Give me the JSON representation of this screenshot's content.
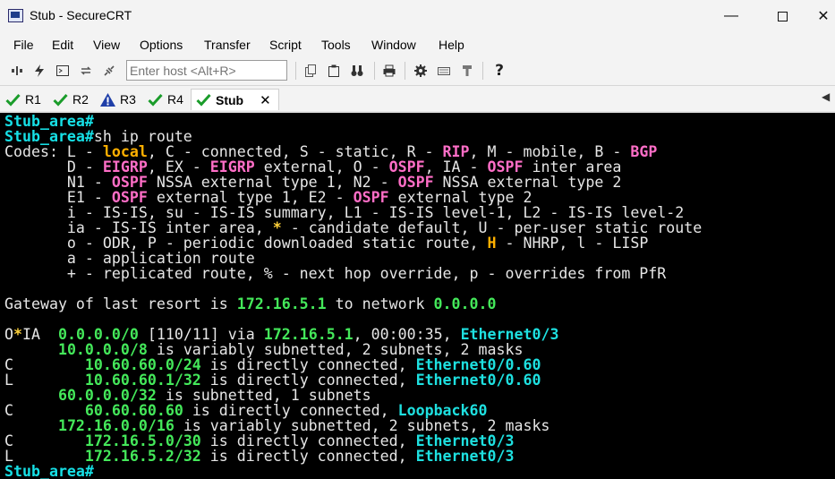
{
  "window": {
    "title": "Stub - SecureCRT",
    "min_glyph": "—",
    "close_glyph": "✕"
  },
  "menu": [
    "File",
    "Edit",
    "View",
    "Options",
    "Transfer",
    "Script",
    "Tools",
    "Window",
    "Help"
  ],
  "toolbar": {
    "host_placeholder": "Enter host <Alt+R>",
    "help_glyph": "?"
  },
  "tabs": [
    {
      "label": "R1",
      "status": "connected"
    },
    {
      "label": "R2",
      "status": "connected"
    },
    {
      "label": "R3",
      "status": "warning"
    },
    {
      "label": "R4",
      "status": "connected"
    },
    {
      "label": "Stub",
      "status": "connected",
      "active": true,
      "close": "✕"
    }
  ],
  "tab_scroll_glyph": "◀",
  "terminal": {
    "lines": [
      [
        {
          "t": "Stub_area#",
          "c": "prompt"
        }
      ],
      [
        {
          "t": "Stub_area#",
          "c": "prompt"
        },
        {
          "t": "sh ip route"
        }
      ],
      [
        {
          "t": "Codes: L - "
        },
        {
          "t": "local",
          "c": "kw-orange"
        },
        {
          "t": ", C - connected, S - static, R - "
        },
        {
          "t": "RIP",
          "c": "kw-pink"
        },
        {
          "t": ", M - mobile, B - "
        },
        {
          "t": "BGP",
          "c": "kw-pink"
        }
      ],
      [
        {
          "t": "       D - "
        },
        {
          "t": "EIGRP",
          "c": "kw-pink"
        },
        {
          "t": ", EX - "
        },
        {
          "t": "EIGRP",
          "c": "kw-pink"
        },
        {
          "t": " external, O - "
        },
        {
          "t": "OSPF",
          "c": "kw-pink"
        },
        {
          "t": ", IA - "
        },
        {
          "t": "OSPF",
          "c": "kw-pink"
        },
        {
          "t": " inter area"
        }
      ],
      [
        {
          "t": "       N1 - "
        },
        {
          "t": "OSPF",
          "c": "kw-pink"
        },
        {
          "t": " NSSA external type 1, N2 - "
        },
        {
          "t": "OSPF",
          "c": "kw-pink"
        },
        {
          "t": " NSSA external type 2"
        }
      ],
      [
        {
          "t": "       E1 - "
        },
        {
          "t": "OSPF",
          "c": "kw-pink"
        },
        {
          "t": " external type 1, E2 - "
        },
        {
          "t": "OSPF",
          "c": "kw-pink"
        },
        {
          "t": " external type 2"
        }
      ],
      [
        {
          "t": "       i - IS-IS, su - IS-IS summary, L1 - IS-IS level-1, L2 - IS-IS level-2"
        }
      ],
      [
        {
          "t": "       ia - IS-IS inter area, "
        },
        {
          "t": "*",
          "c": "kw-yellow"
        },
        {
          "t": " - candidate default, U - per-user static route"
        }
      ],
      [
        {
          "t": "       o - ODR, P - periodic downloaded static route, "
        },
        {
          "t": "H",
          "c": "kw-orange"
        },
        {
          "t": " - NHRP, l - LISP"
        }
      ],
      [
        {
          "t": "       a - application route"
        }
      ],
      [
        {
          "t": "       + - replicated route, % - next hop override, p - overrides from PfR"
        }
      ],
      [
        {
          "t": ""
        }
      ],
      [
        {
          "t": "Gateway of last resort is "
        },
        {
          "t": "172.16.5.1",
          "c": "ip"
        },
        {
          "t": " to network "
        },
        {
          "t": "0.0.0.0",
          "c": "ip"
        }
      ],
      [
        {
          "t": ""
        }
      ],
      [
        {
          "t": "O"
        },
        {
          "t": "*",
          "c": "kw-yellow"
        },
        {
          "t": "IA  "
        },
        {
          "t": "0.0.0.0/0",
          "c": "ip"
        },
        {
          "t": " [110/11] via "
        },
        {
          "t": "172.16.5.1",
          "c": "ip"
        },
        {
          "t": ", 00:00:35, "
        },
        {
          "t": "Ethernet0/3",
          "c": "iface"
        }
      ],
      [
        {
          "t": "      "
        },
        {
          "t": "10.0.0.0/8",
          "c": "ip"
        },
        {
          "t": " is variably subnetted, 2 subnets, 2 masks"
        }
      ],
      [
        {
          "t": "C        "
        },
        {
          "t": "10.60.60.0/24",
          "c": "ip"
        },
        {
          "t": " is directly connected, "
        },
        {
          "t": "Ethernet0/0.60",
          "c": "iface"
        }
      ],
      [
        {
          "t": "L        "
        },
        {
          "t": "10.60.60.1/32",
          "c": "ip"
        },
        {
          "t": " is directly connected, "
        },
        {
          "t": "Ethernet0/0.60",
          "c": "iface"
        }
      ],
      [
        {
          "t": "      "
        },
        {
          "t": "60.0.0.0/32",
          "c": "ip"
        },
        {
          "t": " is subnetted, 1 subnets"
        }
      ],
      [
        {
          "t": "C        "
        },
        {
          "t": "60.60.60.60",
          "c": "ip"
        },
        {
          "t": " is directly connected, "
        },
        {
          "t": "Loopback60",
          "c": "iface"
        }
      ],
      [
        {
          "t": "      "
        },
        {
          "t": "172.16.0.0/16",
          "c": "ip"
        },
        {
          "t": " is variably subnetted, 2 subnets, 2 masks"
        }
      ],
      [
        {
          "t": "C        "
        },
        {
          "t": "172.16.5.0/30",
          "c": "ip"
        },
        {
          "t": " is directly connected, "
        },
        {
          "t": "Ethernet0/3",
          "c": "iface"
        }
      ],
      [
        {
          "t": "L        "
        },
        {
          "t": "172.16.5.2/32",
          "c": "ip"
        },
        {
          "t": " is directly connected, "
        },
        {
          "t": "Ethernet0/3",
          "c": "iface"
        }
      ],
      [
        {
          "t": "Stub_area#",
          "c": "prompt"
        }
      ]
    ]
  },
  "colors": {
    "prompt": "#16e0e6",
    "keyword": "#ff6ec7",
    "highlight": "#ffb000",
    "ip": "#44e85a",
    "interface": "#1ee0e0",
    "check": "#1a9c2a",
    "warning": "#1f3fa8"
  }
}
